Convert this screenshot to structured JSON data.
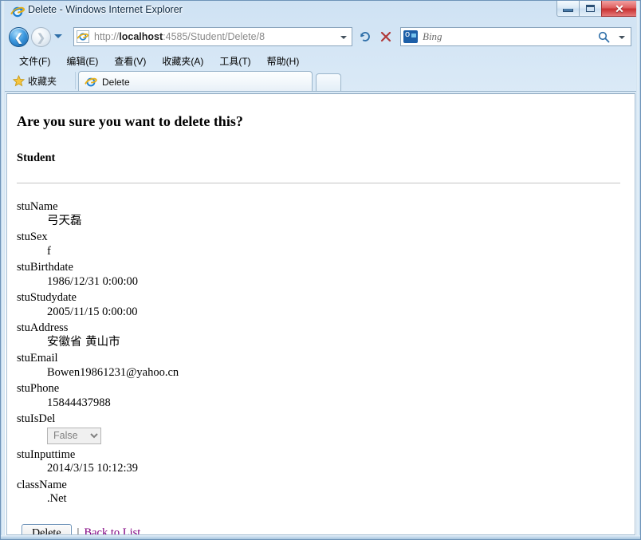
{
  "window": {
    "title": "Delete - Windows Internet Explorer",
    "icon": "ie-icon",
    "buttons": {
      "minimize": "minimize-button",
      "maximize": "maximize-button",
      "close": "✕"
    }
  },
  "nav": {
    "back": "back-button",
    "forward": "forward-button",
    "history_dropdown": "history-dropdown",
    "address": {
      "scheme": "http://",
      "host": "localhost",
      "rest": ":4585/Student/Delete/8",
      "full": "http://localhost:4585/Student/Delete/8"
    },
    "refresh": "refresh-button",
    "stop": "stop-button",
    "search": {
      "provider": "bing-icon",
      "placeholder": "Bing",
      "go": "search-icon",
      "dropdown": "search-provider-dropdown"
    }
  },
  "menubar": {
    "items": [
      {
        "label": "文件(F)"
      },
      {
        "label": "编辑(E)"
      },
      {
        "label": "查看(V)"
      },
      {
        "label": "收藏夹(A)"
      },
      {
        "label": "工具(T)"
      },
      {
        "label": "帮助(H)"
      }
    ]
  },
  "favorites": {
    "label": "收藏夹",
    "icon": "star-icon"
  },
  "tabs": {
    "items": [
      {
        "label": "Delete",
        "icon": "ie-icon"
      }
    ],
    "new_tab": "new-tab-button"
  },
  "page": {
    "heading": "Are you sure you want to delete this?",
    "subheading": "Student",
    "fields": [
      {
        "name": "stuName",
        "value": "弓天磊",
        "cjk": true,
        "type": "text"
      },
      {
        "name": "stuSex",
        "value": "f",
        "cjk": false,
        "type": "text"
      },
      {
        "name": "stuBirthdate",
        "value": "1986/12/31 0:00:00",
        "cjk": false,
        "type": "text"
      },
      {
        "name": "stuStudydate",
        "value": "2005/11/15 0:00:00",
        "cjk": false,
        "type": "text"
      },
      {
        "name": "stuAddress",
        "value": "安徽省 黄山市",
        "cjk": true,
        "type": "text"
      },
      {
        "name": "stuEmail",
        "value": "Bowen19861231@yahoo.cn",
        "cjk": false,
        "type": "text"
      },
      {
        "name": "stuPhone",
        "value": "15844437988",
        "cjk": false,
        "type": "text"
      },
      {
        "name": "stuIsDel",
        "value": "False",
        "cjk": false,
        "type": "select"
      },
      {
        "name": "stuInputtime",
        "value": "2014/3/15 10:12:39",
        "cjk": false,
        "type": "text"
      },
      {
        "name": "className",
        "value": ".Net",
        "cjk": false,
        "type": "text"
      }
    ],
    "actions": {
      "delete_label": "Delete",
      "separator": "|",
      "back_link": "Back to List"
    }
  },
  "colors": {
    "visited_link": "#800080",
    "titlebar_text": "#0d2a44",
    "close_button": "#c83131"
  }
}
